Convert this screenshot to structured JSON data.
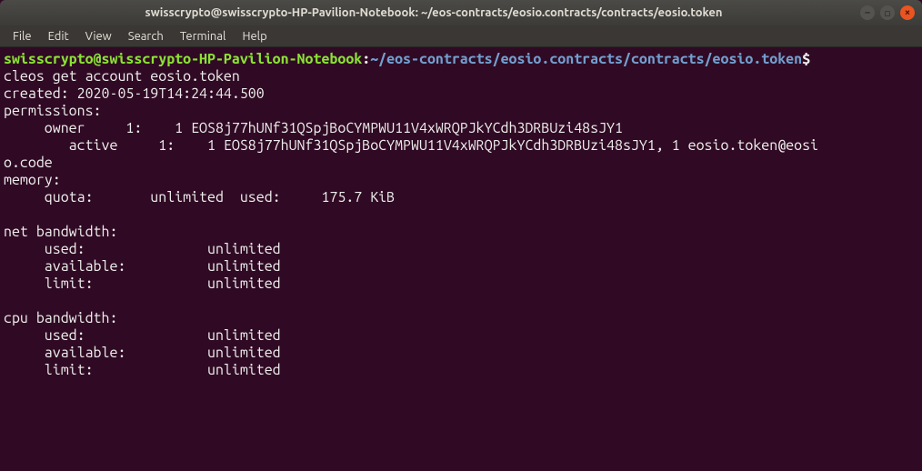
{
  "window": {
    "title": "swisscrypto@swisscrypto-HP-Pavilion-Notebook: ~/eos-contracts/eosio.contracts/contracts/eosio.token"
  },
  "menu": {
    "file": "File",
    "edit": "Edit",
    "view": "View",
    "search": "Search",
    "terminal": "Terminal",
    "help": "Help"
  },
  "prompt": {
    "user_host": "swisscrypto@swisscrypto-HP-Pavilion-Notebook",
    "colon": ":",
    "path": "~/eos-contracts/eosio.contracts/contracts/eosio.token",
    "symbol": "$"
  },
  "command": "cleos get account eosio.token",
  "output": {
    "created_line": "created: 2020-05-19T14:24:44.500",
    "permissions_label": "permissions: ",
    "owner_line": "     owner     1:    1 EOS8j77hUNf31QSpjBoCYMPWU11V4xWRQPJkYCdh3DRBUzi48sJY1",
    "active_line": "        active     1:    1 EOS8j77hUNf31QSpjBoCYMPWU11V4xWRQPJkYCdh3DRBUzi48sJY1, 1 eosio.token@eosi",
    "active_wrap": "o.code",
    "memory_label": "memory: ",
    "memory_quota": "     quota:       unlimited  used:     175.7 KiB  ",
    "blank1": "",
    "net_label": "net bandwidth: ",
    "net_used": "     used:               unlimited",
    "net_avail": "     available:          unlimited",
    "net_limit": "     limit:              unlimited",
    "blank2": "",
    "cpu_label": "cpu bandwidth:",
    "cpu_used": "     used:               unlimited",
    "cpu_avail": "     available:          unlimited",
    "cpu_limit": "     limit:              unlimited"
  }
}
